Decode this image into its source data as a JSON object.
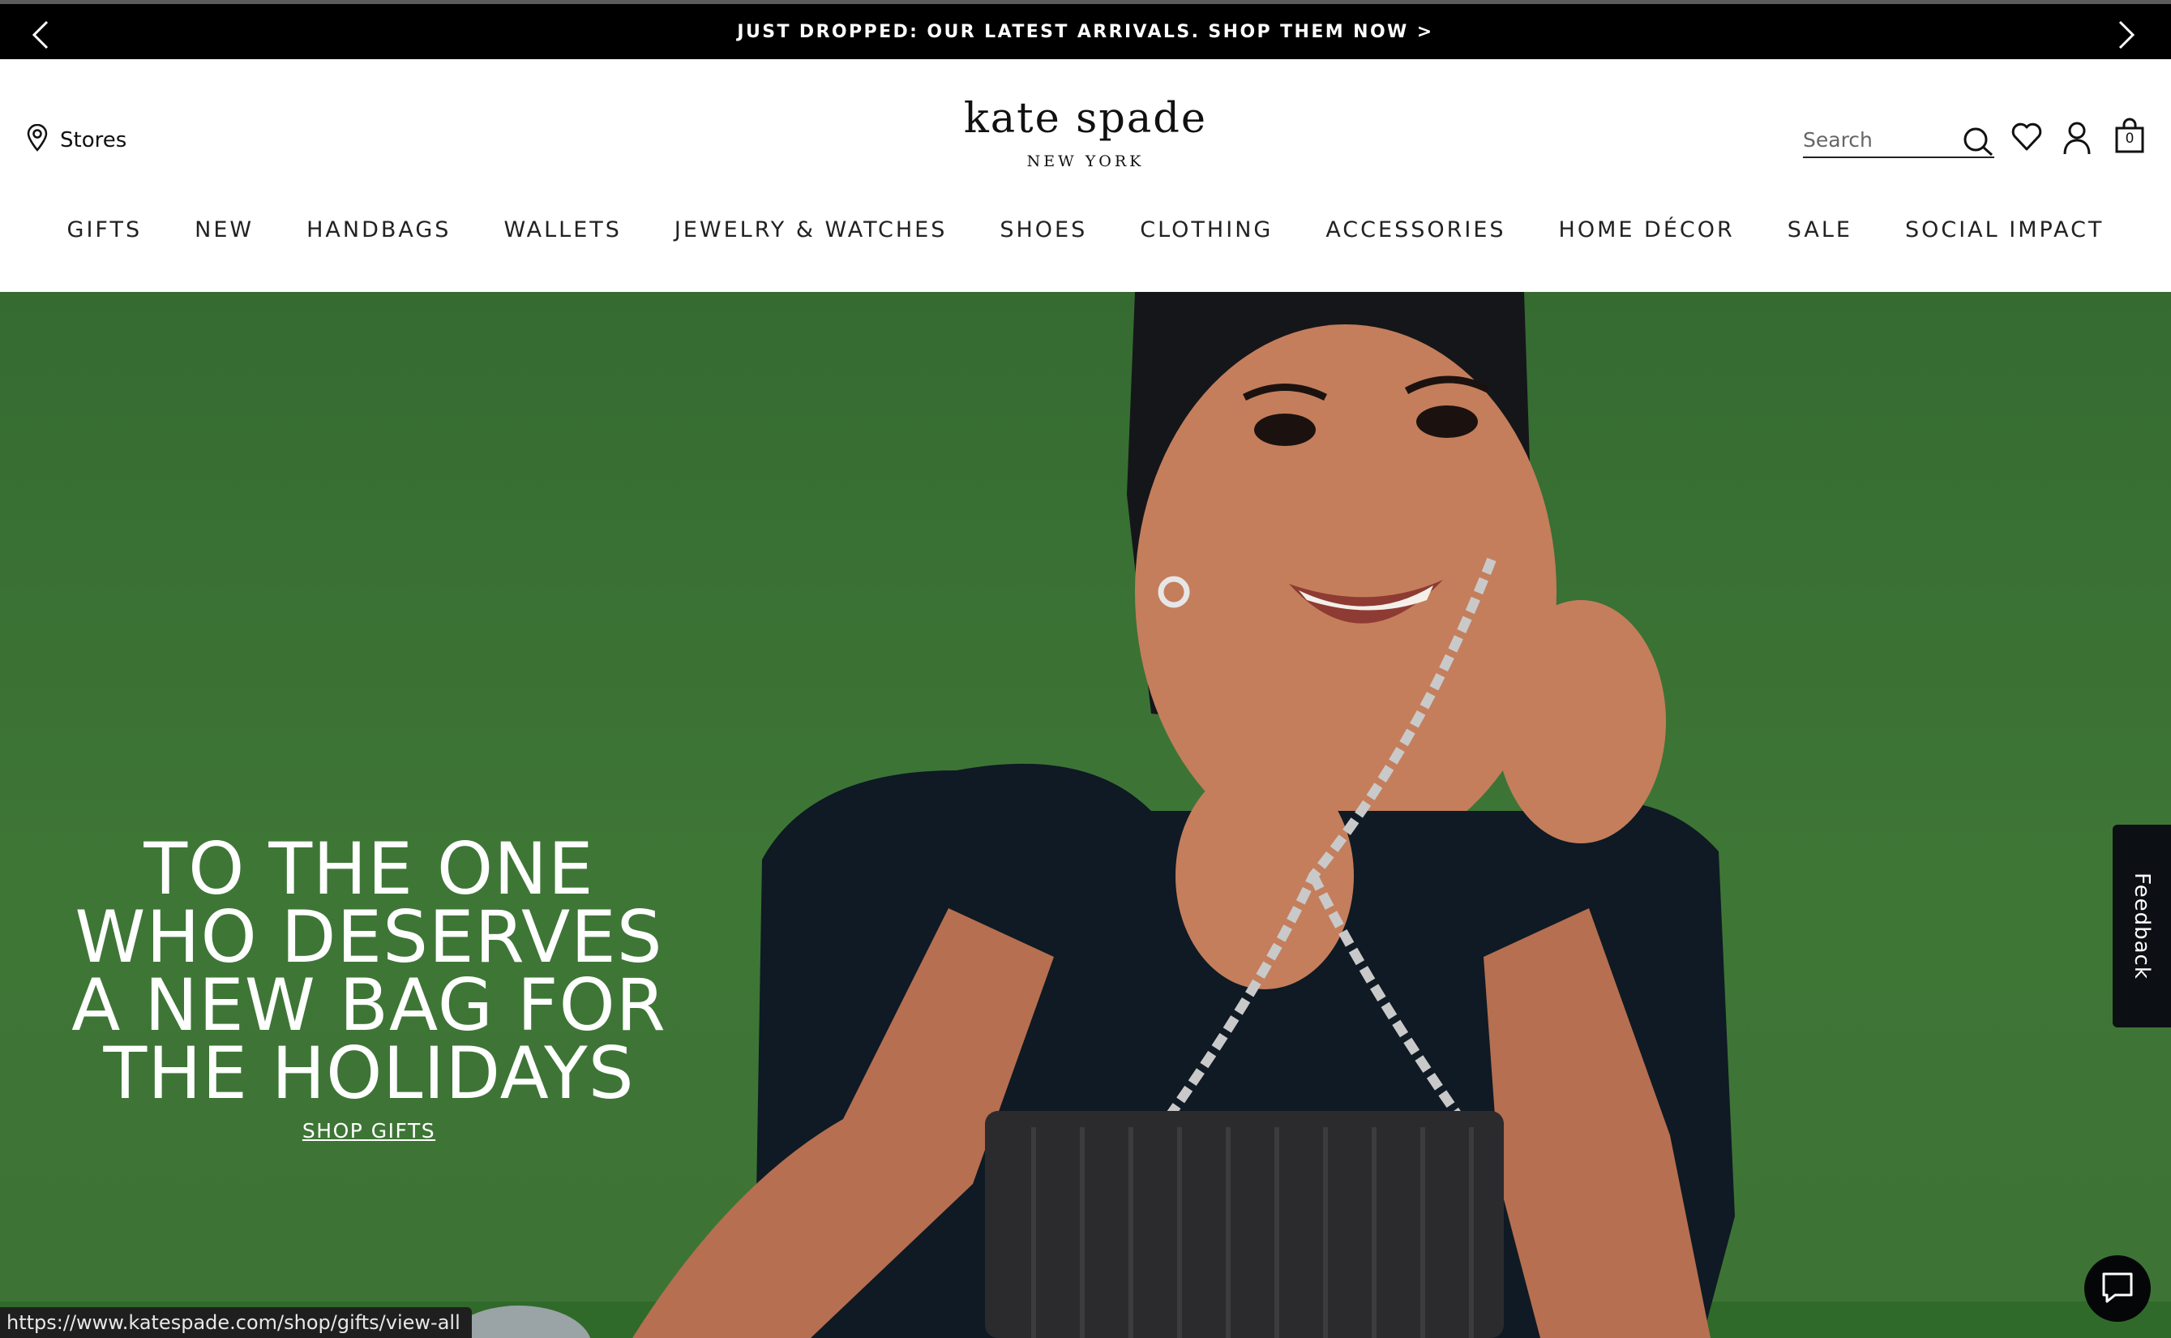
{
  "promo": {
    "text": "JUST DROPPED: OUR LATEST ARRIVALS. SHOP THEM NOW >"
  },
  "header": {
    "stores_label": "Stores",
    "logo_main": "kate spade",
    "logo_sub": "NEW YORK",
    "search_placeholder": "Search",
    "bag_count": "0"
  },
  "nav": {
    "items": [
      "GIFTS",
      "NEW",
      "HANDBAGS",
      "WALLETS",
      "JEWELRY & WATCHES",
      "SHOES",
      "CLOTHING",
      "ACCESSORIES",
      "HOME DÉCOR",
      "SALE",
      "SOCIAL IMPACT"
    ]
  },
  "hero": {
    "headline": "TO THE ONE\nWHO DESERVES\nA NEW BAG FOR\nTHE HOLIDAYS",
    "cta": "SHOP GIFTS",
    "background_color": "#3e7636"
  },
  "feedback": {
    "label": "Feedback"
  },
  "status_bar": {
    "url": "https://www.katespade.com/shop/gifts/view-all"
  }
}
